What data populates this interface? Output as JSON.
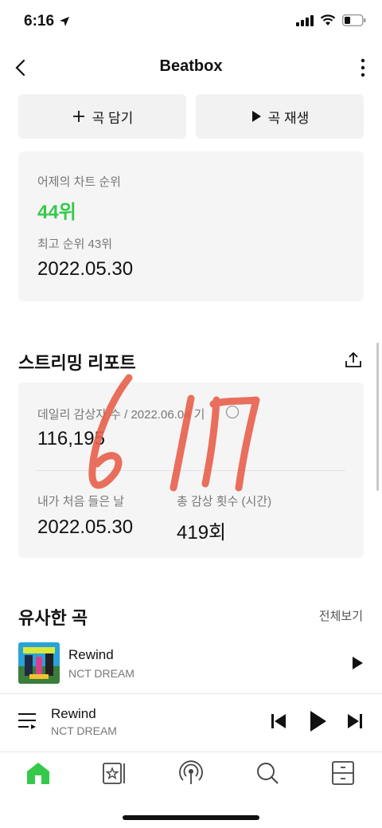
{
  "status": {
    "time": "6:16"
  },
  "header": {
    "title": "Beatbox"
  },
  "actions": {
    "add_label": "곡 담기",
    "play_label": "곡 재생"
  },
  "chart": {
    "yesterday_label": "어제의 차트 순위",
    "yesterday_value": "44위",
    "best_label": "최고 순위 43위",
    "best_date": "2022.05.30"
  },
  "report": {
    "title": "스트리밍 리포트",
    "daily_label": "데일리 감상자 수 / 2022.06.04 기",
    "daily_value": "116,195",
    "first_label": "내가 처음 들은 날",
    "first_value": "2022.05.30",
    "total_label": "총 감상 횟수 (시간)",
    "total_value": "419회",
    "handwriting": "6/17"
  },
  "similar": {
    "title": "유사한 곡",
    "see_all": "전체보기",
    "items": [
      {
        "title": "Rewind",
        "artist": "NCT DREAM"
      }
    ]
  },
  "player": {
    "title": "Rewind",
    "artist": "NCT DREAM"
  },
  "tabs": [
    "home-icon",
    "library-icon",
    "podcast-icon",
    "search-icon",
    "storage-icon"
  ],
  "colors": {
    "accent": "#34c94a",
    "scribble": "#e8604c"
  }
}
